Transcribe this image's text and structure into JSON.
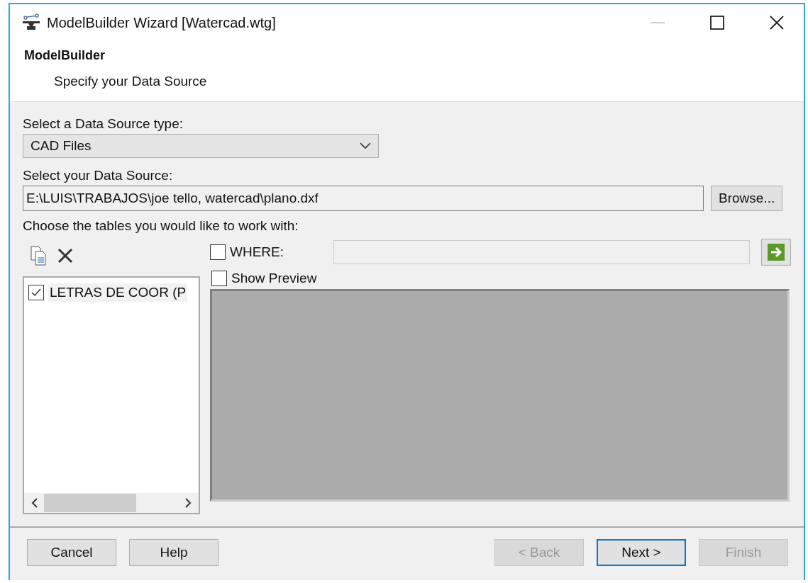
{
  "window": {
    "title": "ModelBuilder Wizard [Watercad.wtg]"
  },
  "header": {
    "title": "ModelBuilder",
    "subtitle": "Specify your Data Source"
  },
  "source_type": {
    "label": "Select a Data Source type:",
    "value": "CAD Files"
  },
  "source": {
    "label": "Select your Data Source:",
    "value": "E:\\LUIS\\TRABAJOS\\joe tello, watercad\\plano.dxf",
    "browse": "Browse..."
  },
  "tables": {
    "label": "Choose the tables you would like to work with:",
    "items": [
      {
        "label": "LETRAS DE COOR (P",
        "checked": true
      }
    ]
  },
  "where": {
    "label": "WHERE:",
    "checked": false
  },
  "preview": {
    "label": "Show Preview",
    "checked": false
  },
  "buttons_left": [
    {
      "label": "Cancel",
      "disabled": false,
      "default": false
    },
    {
      "label": "Help",
      "disabled": false,
      "default": false
    }
  ],
  "buttons_right": [
    {
      "label": "< Back",
      "disabled": true,
      "default": false
    },
    {
      "label": "Next >",
      "disabled": false,
      "default": true
    },
    {
      "label": "Finish",
      "disabled": true,
      "default": false
    }
  ]
}
